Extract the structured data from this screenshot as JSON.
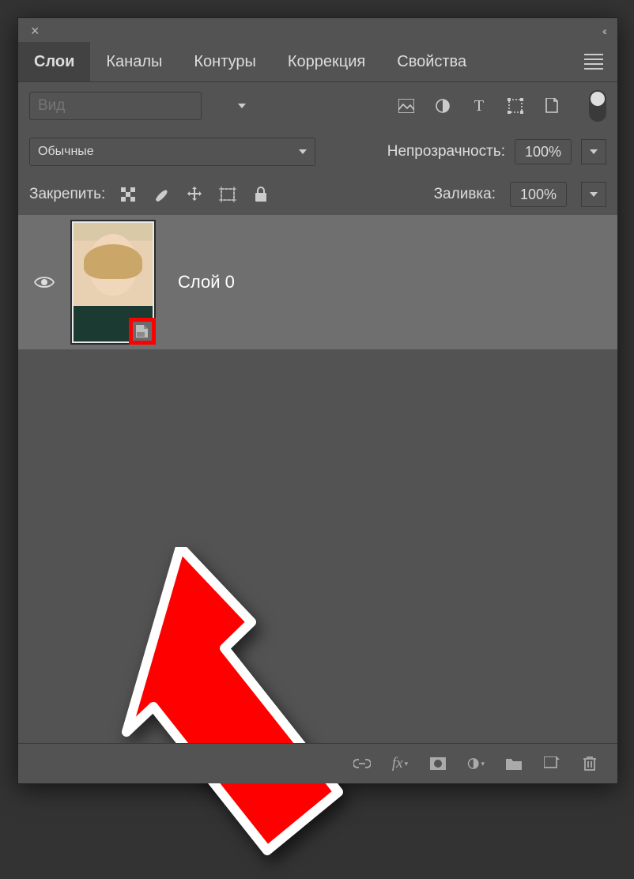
{
  "panel": {
    "tabs": [
      "Слои",
      "Каналы",
      "Контуры",
      "Коррекция",
      "Свойства"
    ],
    "active_tab": 0
  },
  "search": {
    "placeholder": "Вид"
  },
  "filter_icons": [
    "image-filter-icon",
    "adjustment-filter-icon",
    "type-filter-icon",
    "shape-filter-icon",
    "smartobject-filter-icon"
  ],
  "blend": {
    "mode": "Обычные",
    "opacity_label": "Непрозрачность:",
    "opacity_value": "100%"
  },
  "lock": {
    "label": "Закрепить:",
    "fill_label": "Заливка:",
    "fill_value": "100%"
  },
  "layer": {
    "name": "Слой 0"
  },
  "footer_icons": [
    "link-icon",
    "fx-icon",
    "mask-icon",
    "adjustment-icon",
    "group-icon",
    "new-layer-icon",
    "trash-icon"
  ]
}
